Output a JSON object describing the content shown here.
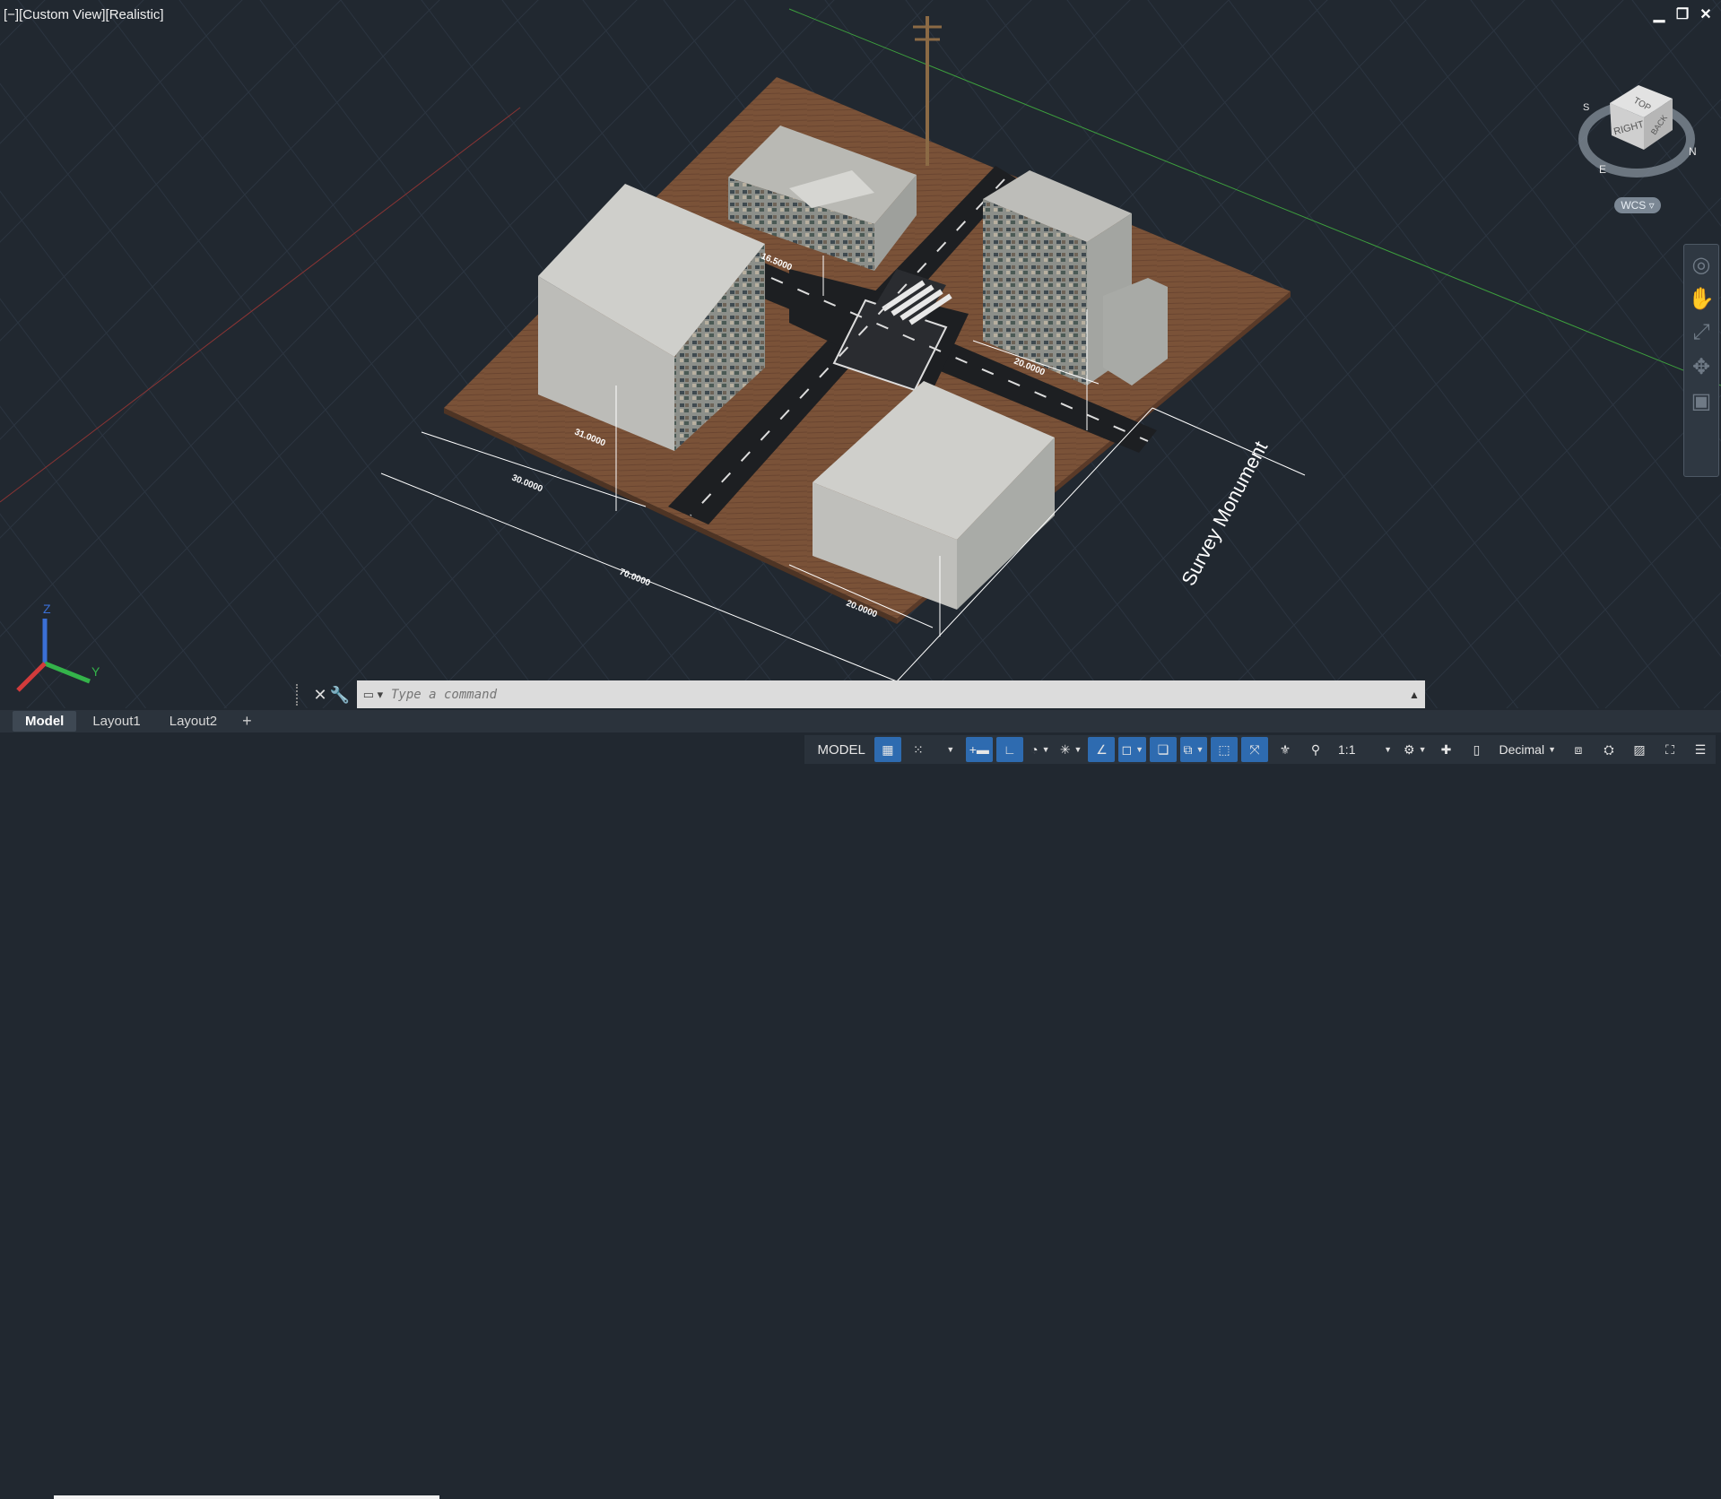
{
  "viewport": {
    "label": {
      "minus": "[−]",
      "view": "[Custom View]",
      "style": "[Realistic]"
    },
    "window_controls": {
      "minimize": "▁",
      "restore": "❐",
      "close": "✕"
    },
    "viewcube": {
      "top": "TOP",
      "right": "RIGHT",
      "back": "BACK",
      "compass": [
        "S",
        "E",
        "N"
      ]
    },
    "wcs_label": "WCS ▿",
    "ucs": {
      "x": "X",
      "y": "Y",
      "z": "Z"
    },
    "navbar_icons": [
      "steering-wheel-icon",
      "pan-icon",
      "zoom-icon",
      "orbit-icon",
      "showmotion-icon"
    ]
  },
  "drawing": {
    "annotation": "Survey Monument",
    "dimensions": [
      "30.0000",
      "70.0000",
      "20.0000",
      "20.0000",
      "16.5000",
      "31.0000"
    ]
  },
  "command_line": {
    "close": "✕",
    "settings": "🔧",
    "placeholder": "Type a command",
    "up_arrow": "▲"
  },
  "layout_tabs": [
    {
      "label": "Model",
      "active": true
    },
    {
      "label": "Layout1",
      "active": false
    },
    {
      "label": "Layout2",
      "active": false
    }
  ],
  "tab_add": "+",
  "status_bar": {
    "model_label": "MODEL",
    "scale": "1:1",
    "units": "Decimal"
  },
  "colors": {
    "background": "#212830",
    "grid": "#2c3540",
    "axis_green": "#3d9f3d",
    "axis_red": "#8a3434",
    "ground": "#7a5238",
    "road": "#1d1f22",
    "building": "#c8c8c4",
    "toggle_on": "#2e6bb0"
  }
}
